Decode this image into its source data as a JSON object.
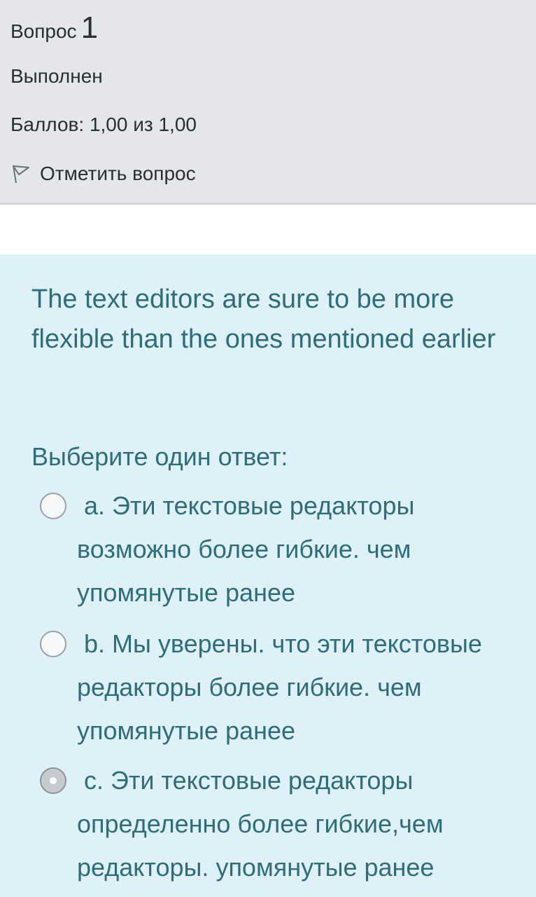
{
  "info": {
    "question_word": "Вопрос",
    "question_number": "1",
    "status": "Выполнен",
    "grade": "Баллов: 1,00 из 1,00",
    "flag_label": "Отметить вопрос",
    "flag_icon": "flag-icon"
  },
  "question": {
    "text": "The text editors are sure to be more flexible than the ones mentioned earlier",
    "prompt": "Выберите один ответ:",
    "options": [
      {
        "letter": "a.",
        "text": "Эти текстовые редакторы возможно более гибкие. чем упомянутые ранее",
        "selected": false
      },
      {
        "letter": "b.",
        "text": "Мы уверены. что эти текстовые редакторы более гибкие. чем упомянутые ранее",
        "selected": false
      },
      {
        "letter": "c.",
        "text": "Эти текстовые редакторы определенно более гибкие,чем редакторы. упомянутые ранее",
        "selected": true
      }
    ]
  },
  "colors": {
    "info_bg": "#e4e6ea",
    "content_bg": "#def1f8",
    "text_teal": "#2f6d7a",
    "text_dark": "#2a2e33"
  }
}
